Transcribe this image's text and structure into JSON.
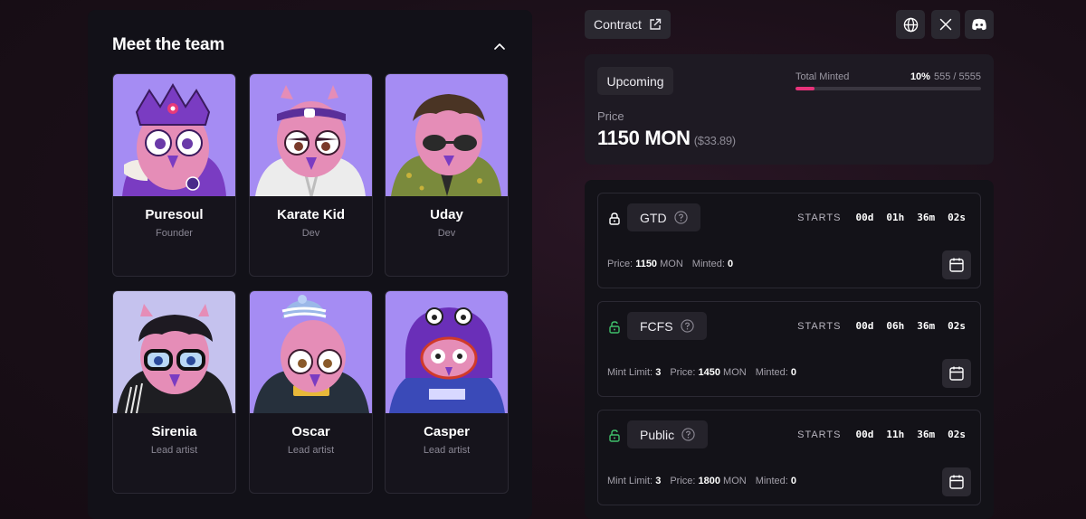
{
  "team": {
    "title": "Meet the team",
    "collapse_icon": "chevron-up-icon",
    "members": [
      {
        "name": "Puresoul",
        "role": "Founder"
      },
      {
        "name": "Karate Kid",
        "role": "Dev"
      },
      {
        "name": "Uday",
        "role": "Dev"
      },
      {
        "name": "Sirenia",
        "role": "Lead artist"
      },
      {
        "name": "Oscar",
        "role": "Lead artist"
      },
      {
        "name": "Casper",
        "role": "Lead artist"
      }
    ]
  },
  "toolbar": {
    "contract_label": "Contract",
    "icons": [
      "globe-icon",
      "x-icon",
      "discord-icon"
    ]
  },
  "mint": {
    "status": "Upcoming",
    "total_minted_label": "Total Minted",
    "percent": "10%",
    "minted": "555",
    "separator": "/",
    "supply": "5555",
    "progress_fraction": 0.1,
    "price_label": "Price",
    "price": "1150 MON",
    "price_usd": "($33.89)"
  },
  "phases": [
    {
      "name": "GTD",
      "locked": true,
      "starts_label": "STARTS",
      "countdown": [
        "00d",
        "01h",
        "36m",
        "02s"
      ],
      "price_label": "Price:",
      "price_value": "1150",
      "price_unit": "MON",
      "minted_label": "Minted:",
      "minted_value": "0"
    },
    {
      "name": "FCFS",
      "locked": false,
      "starts_label": "STARTS",
      "countdown": [
        "00d",
        "06h",
        "36m",
        "02s"
      ],
      "mint_limit_label": "Mint Limit:",
      "mint_limit_value": "3",
      "price_label": "Price:",
      "price_value": "1450",
      "price_unit": "MON",
      "minted_label": "Minted:",
      "minted_value": "0"
    },
    {
      "name": "Public",
      "locked": false,
      "starts_label": "STARTS",
      "countdown": [
        "00d",
        "11h",
        "36m",
        "02s"
      ],
      "mint_limit_label": "Mint Limit:",
      "mint_limit_value": "3",
      "price_label": "Price:",
      "price_value": "1800",
      "price_unit": "MON",
      "minted_label": "Minted:",
      "minted_value": "0"
    }
  ],
  "colors": {
    "accent": "#e8327a",
    "unlocked_lock": "#3fbf6a",
    "locked_lock": "#ffffff"
  }
}
